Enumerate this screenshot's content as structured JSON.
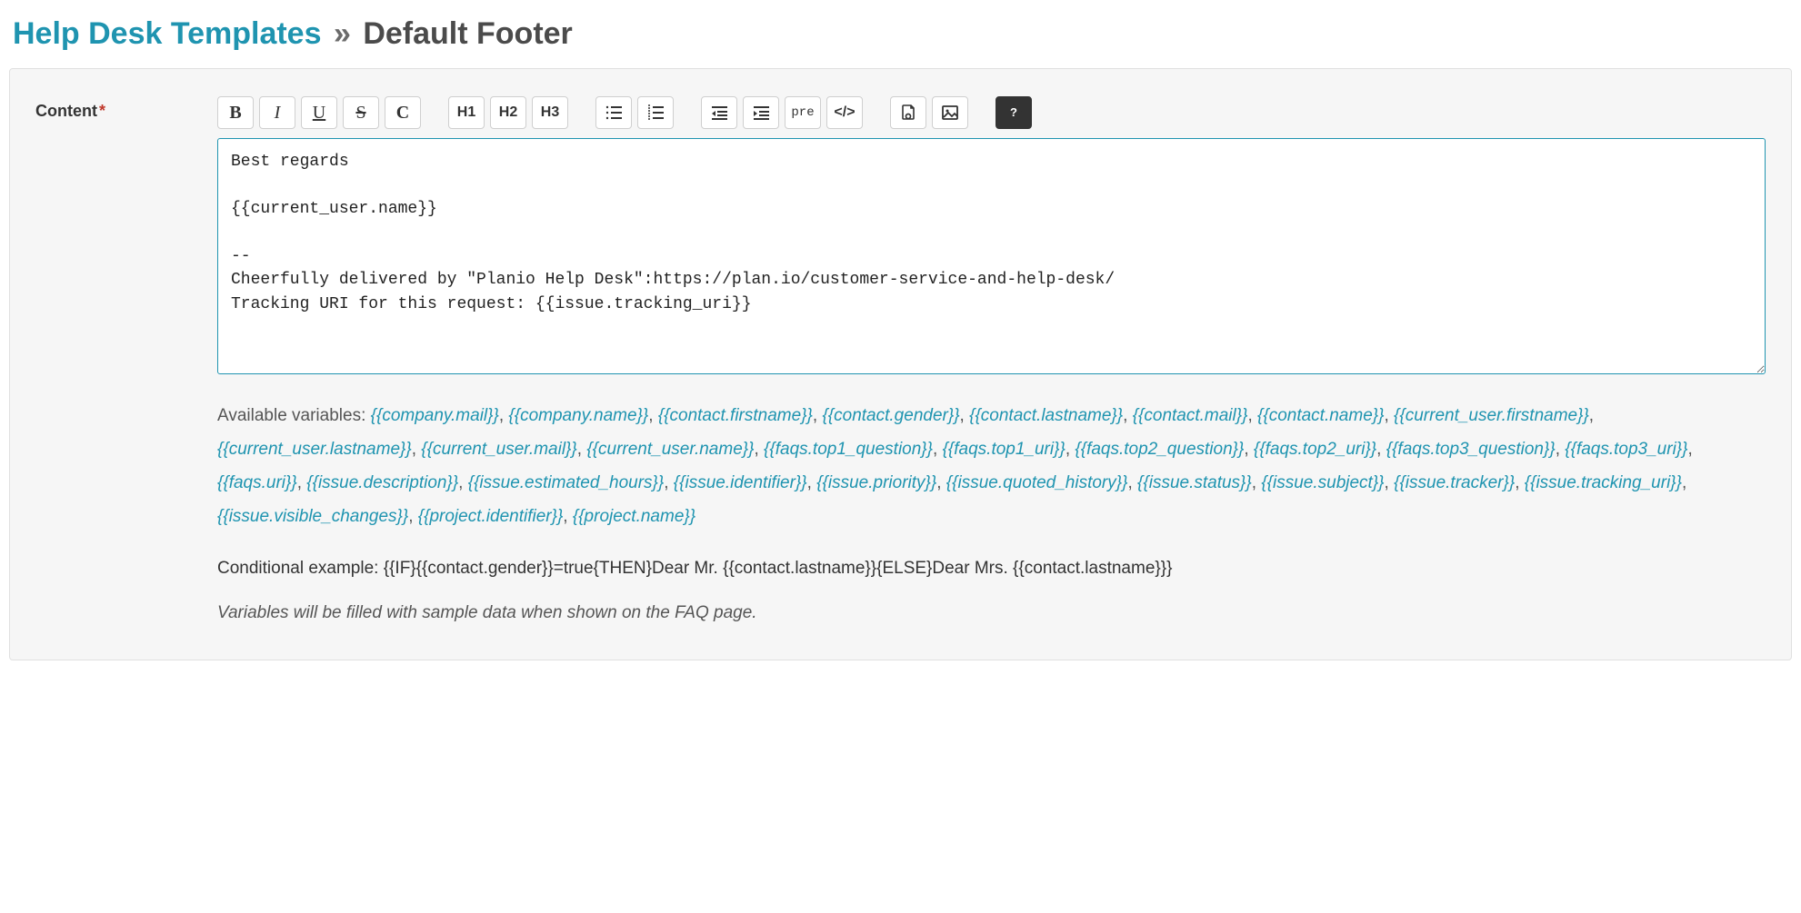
{
  "header": {
    "breadcrumb_link": "Help Desk Templates",
    "separator": "»",
    "page_name": "Default Footer"
  },
  "form": {
    "content_label": "Content",
    "required_mark": "*",
    "content_value": "Best regards\n\n{{current_user.name}}\n\n--\nCheerfully delivered by \"Planio Help Desk\":https://plan.io/customer-service-and-help-desk/\nTracking URI for this request: {{issue.tracking_uri}}"
  },
  "toolbar": {
    "bold": "B",
    "italic": "I",
    "underline": "U",
    "strike": "S",
    "c": "C",
    "h1": "H1",
    "h2": "H2",
    "h3": "H3",
    "pre": "pre",
    "code": "</>"
  },
  "hints": {
    "available_label": "Available variables: ",
    "variables": [
      "{{company.mail}}",
      "{{company.name}}",
      "{{contact.firstname}}",
      "{{contact.gender}}",
      "{{contact.lastname}}",
      "{{contact.mail}}",
      "{{contact.name}}",
      "{{current_user.firstname}}",
      "{{current_user.lastname}}",
      "{{current_user.mail}}",
      "{{current_user.name}}",
      "{{faqs.top1_question}}",
      "{{faqs.top1_uri}}",
      "{{faqs.top2_question}}",
      "{{faqs.top2_uri}}",
      "{{faqs.top3_question}}",
      "{{faqs.top3_uri}}",
      "{{faqs.uri}}",
      "{{issue.description}}",
      "{{issue.estimated_hours}}",
      "{{issue.identifier}}",
      "{{issue.priority}}",
      "{{issue.quoted_history}}",
      "{{issue.status}}",
      "{{issue.subject}}",
      "{{issue.tracker}}",
      "{{issue.tracking_uri}}",
      "{{issue.visible_changes}}",
      "{{project.identifier}}",
      "{{project.name}}"
    ],
    "conditional_example": "Conditional example: {{IF}{{contact.gender}}=true{THEN}Dear Mr. {{contact.lastname}}{ELSE}Dear Mrs. {{contact.lastname}}}",
    "faq_note": "Variables will be filled with sample data when shown on the FAQ page."
  }
}
